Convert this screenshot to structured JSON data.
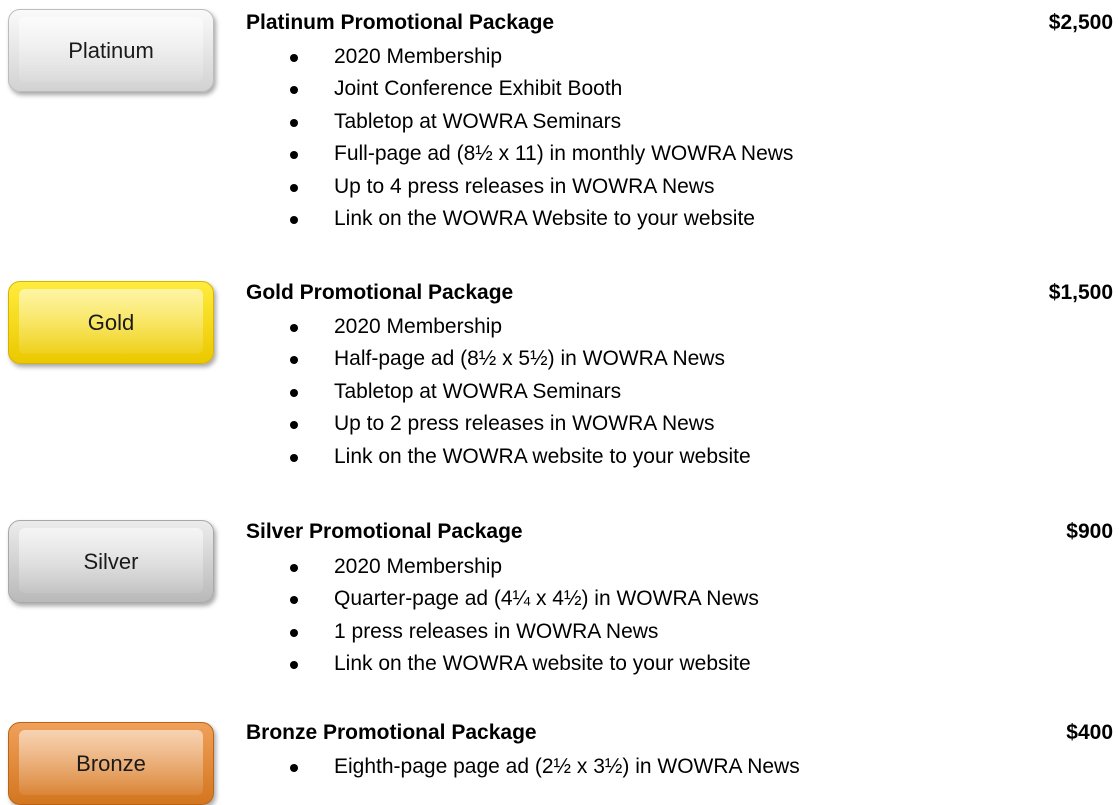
{
  "packages": [
    {
      "badge": "Platinum",
      "title": "Platinum Promotional Package",
      "price": "$2,500",
      "items": [
        "2020 Membership",
        "Joint Conference Exhibit Booth",
        "Tabletop at WOWRA Seminars",
        "Full-page ad (8½ x 11) in monthly WOWRA News",
        "Up to 4 press releases in WOWRA News",
        "Link on the WOWRA Website to your website"
      ]
    },
    {
      "badge": "Gold",
      "title": "Gold Promotional Package",
      "price": "$1,500",
      "items": [
        "2020 Membership",
        "Half-page ad (8½ x 5½) in WOWRA News",
        "Tabletop at WOWRA Seminars",
        "Up to 2 press releases in WOWRA News",
        "Link on the WOWRA website to your website"
      ]
    },
    {
      "badge": "Silver",
      "title": "Silver Promotional Package",
      "price": "$900",
      "items": [
        "2020 Membership",
        "Quarter-page ad (4¼ x 4½) in WOWRA News",
        "1 press releases in WOWRA News",
        "Link on the WOWRA website to your website"
      ]
    },
    {
      "badge": "Bronze",
      "title": "Bronze Promotional Package",
      "price": "$400",
      "items": [
        "Eighth-page page ad (2½ x 3½) in WOWRA News"
      ]
    }
  ]
}
